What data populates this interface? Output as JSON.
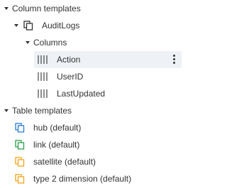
{
  "tree": {
    "column_templates": {
      "label": "Column templates"
    },
    "audit_logs": {
      "label": "AuditLogs"
    },
    "columns": {
      "label": "Columns"
    },
    "column_items": [
      {
        "label": "Action"
      },
      {
        "label": "UserID"
      },
      {
        "label": "LastUpdated"
      }
    ],
    "table_templates": {
      "label": "Table templates"
    },
    "table_items": [
      {
        "label": "hub (default)",
        "icon": "copy-blue-icon",
        "color": "#2a7ad4"
      },
      {
        "label": "link (default)",
        "icon": "copy-green-icon",
        "color": "#2e9e4a"
      },
      {
        "label": "satellite (default)",
        "icon": "copy-orange-icon",
        "color": "#f2a51a"
      },
      {
        "label": "type 2 dimension (default)",
        "icon": "copy-orange-icon",
        "color": "#f2a51a"
      }
    ]
  },
  "colors": {
    "selection_bg": "#eef2f6",
    "text": "#333333"
  }
}
